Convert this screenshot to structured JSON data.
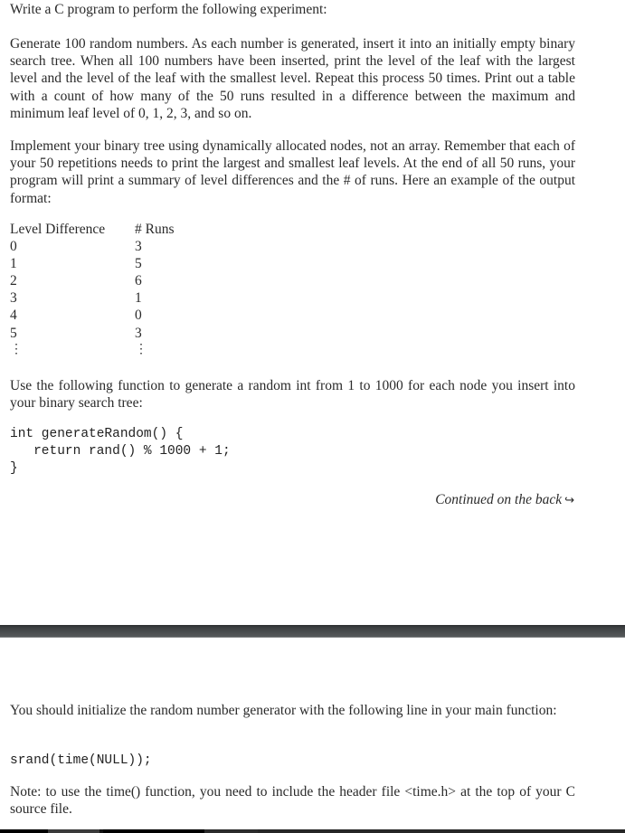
{
  "front_page": {
    "intro": "Write a C program to perform the following experiment:",
    "paragraph_generate": "Generate 100 random numbers. As each number is generated, insert it into an initially empty binary search tree. When all 100 numbers have been inserted, print the level of the leaf with the largest level and the level of the leaf with the smallest level. Repeat this process 50 times. Print out a table with a count of how many of the 50 runs resulted in a difference between the maximum and minimum leaf level of 0, 1, 2, 3, and so on.",
    "paragraph_implement": "Implement your binary tree using dynamically allocated nodes, not an array. Remember that each of your 50 repetitions needs to print the largest and smallest leaf levels. At the end of all 50 runs, your program will print a summary of level differences and the # of runs. Here an example of the output format:",
    "example_table": {
      "headers": [
        "Level Difference",
        "# Runs"
      ],
      "rows": [
        [
          "0",
          "3"
        ],
        [
          "1",
          "5"
        ],
        [
          "2",
          "6"
        ],
        [
          "3",
          "1"
        ],
        [
          "4",
          "0"
        ],
        [
          "5",
          "3"
        ]
      ],
      "continuation": "⋮"
    },
    "paragraph_use_function": "Use the following function to generate a random int from 1 to 1000 for each node you insert into your binary search tree:",
    "code_generate_random": [
      "int generateRandom() {",
      "   return rand() % 1000 + 1;",
      "}"
    ],
    "continued_label": "Continued on the back",
    "continued_arrow": "↪"
  },
  "back_page": {
    "paragraph_init": "You should initialize the random number generator with the following line in your main function:",
    "code_srand": "srand(time(NULL));",
    "paragraph_note": "Note: to use the time() function, you need to include the header file <time.h> at the top of your C source file."
  },
  "colors": {
    "text": "#2a2a2a",
    "separator_bar": "#4f5254",
    "taskbar_segments": [
      "#000000",
      "#3a3a3a",
      "#000000",
      "#111111",
      "#2b2b2b",
      "#333333",
      "#262626"
    ]
  }
}
